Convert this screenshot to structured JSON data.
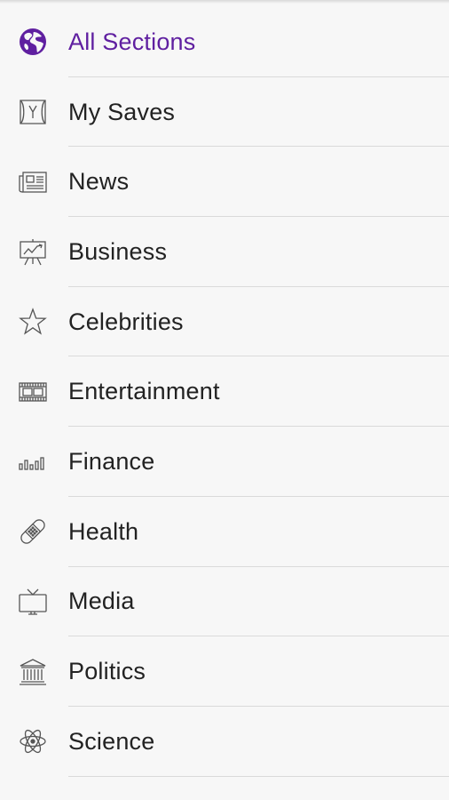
{
  "menu": {
    "items": [
      {
        "label": "All Sections",
        "icon": "globe-icon",
        "active": true
      },
      {
        "label": "My Saves",
        "icon": "saves-icon"
      },
      {
        "label": "News",
        "icon": "newspaper-icon"
      },
      {
        "label": "Business",
        "icon": "presentation-chart-icon"
      },
      {
        "label": "Celebrities",
        "icon": "star-icon"
      },
      {
        "label": "Entertainment",
        "icon": "film-icon"
      },
      {
        "label": "Finance",
        "icon": "bar-chart-icon"
      },
      {
        "label": "Health",
        "icon": "bandage-icon"
      },
      {
        "label": "Media",
        "icon": "tv-icon"
      },
      {
        "label": "Politics",
        "icon": "government-building-icon"
      },
      {
        "label": "Science",
        "icon": "atom-icon"
      }
    ]
  },
  "colors": {
    "accent": "#5f1fa0",
    "text": "#222222",
    "divider": "#dadada",
    "background": "#f7f7f7"
  }
}
